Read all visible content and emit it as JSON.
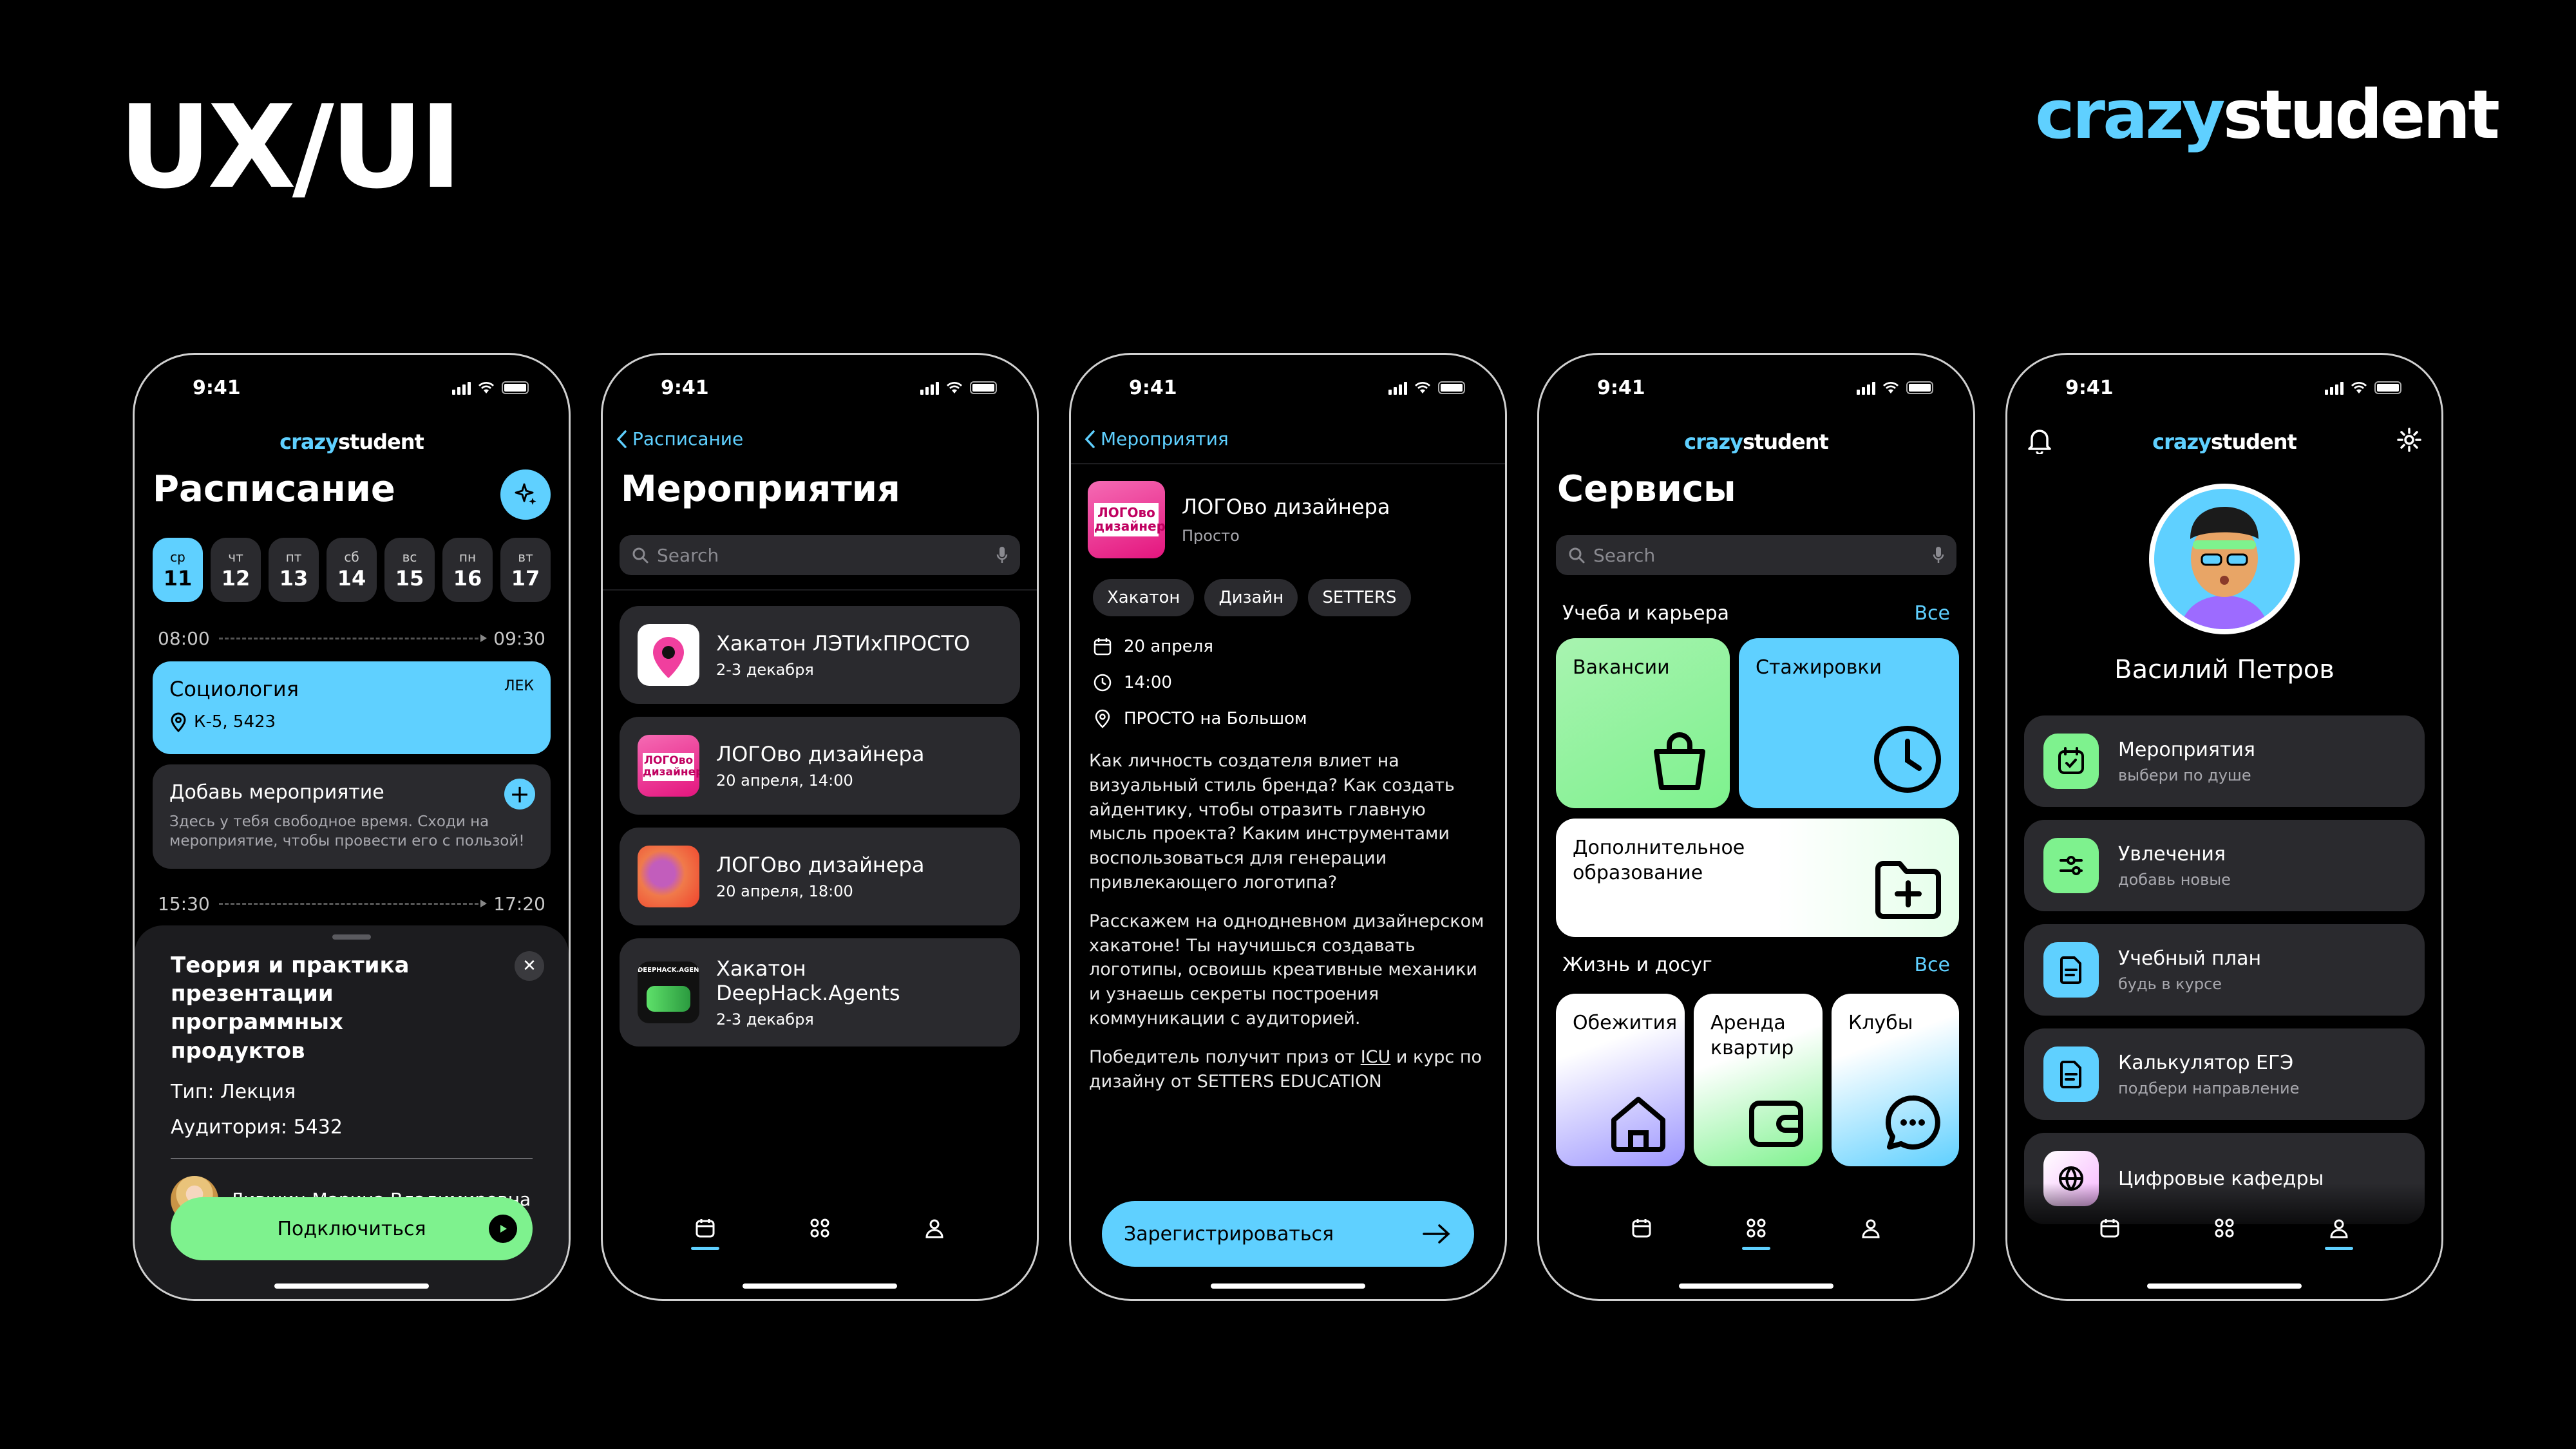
{
  "header": {
    "title": "UX/UI",
    "brand_part1": "crazy",
    "brand_part2": "student"
  },
  "colors": {
    "accent": "#5fd0ff",
    "green": "#7ef28e",
    "card": "#2a2a2e"
  },
  "status_time": "9:41",
  "schedule": {
    "logo1": "crazy",
    "logo2": "student",
    "title": "Расписание",
    "days": [
      {
        "w": "ср",
        "n": "11"
      },
      {
        "w": "чт",
        "n": "12"
      },
      {
        "w": "пт",
        "n": "13"
      },
      {
        "w": "сб",
        "n": "14"
      },
      {
        "w": "вс",
        "n": "15"
      },
      {
        "w": "пн",
        "n": "16"
      },
      {
        "w": "вт",
        "n": "17"
      }
    ],
    "slot1_start": "08:00",
    "slot1_end": "09:30",
    "lesson_title": "Социология",
    "lesson_kind": "ЛЕК",
    "lesson_room": "К-5, 5423",
    "add_title": "Добавь мероприятие",
    "add_desc": "Здесь у тебя свободное время. Сходи на мероприятие, чтобы провести его с пользой!",
    "slot2_start": "15:30",
    "slot2_end": "17:20",
    "sheet_title": "Теория и практика презентации программных продуктов",
    "sheet_type": "Тип: Лекция",
    "sheet_room": "Аудитория: 5432",
    "teacher": "Лившиц Марина Владимировна",
    "connect": "Подключиться"
  },
  "events": {
    "back": "Расписание",
    "title": "Мероприятия",
    "search_placeholder": "Search",
    "items": [
      {
        "title": "Хакатон ЛЭТИхПРОСТО",
        "sub": "2-3 декабря"
      },
      {
        "title": "ЛОГОво дизайнера",
        "sub": "20 апреля, 14:00"
      },
      {
        "title": "ЛОГОво дизайнера",
        "sub": "20 апреля, 18:00"
      },
      {
        "title": "Хакатон",
        "title2": "DeepHack.Agents",
        "sub": "2-3 декабря"
      }
    ],
    "img_logo_text1": "ЛОГОво",
    "img_logo_text2": "дизайнера",
    "img_deephack": "DEEPHACK.AGENTS"
  },
  "detail": {
    "back": "Мероприятия",
    "title": "ЛОГОво дизайнера",
    "org": "Просто",
    "tags": [
      "Хакатон",
      "Дизайн",
      "SETTERS"
    ],
    "date": "20 апреля",
    "time": "14:00",
    "place": "ПРОСТО на Большом",
    "p1": "Как личность создателя влиет на визуальный стиль бренда? Как создать айдентику, чтобы отразить главную мысль проекта? Каким инструментами воспользоваться для генерации привлекающего логотипа?",
    "p2": "Расскажем на однодневном дизайнерском хакатоне! Ты научишься создавать логотипы, освоишь креативные механики и узнаешь секреты построения коммуникации с аудиторией.",
    "p3a": "Победитель получит приз от ",
    "p3b": "ICU",
    "p3c": " и курс по дизайну от SETTERS EDUCATION",
    "register": "Зарегистрироваться"
  },
  "services": {
    "title": "Сервисы",
    "search_placeholder": "Search",
    "sec1": "Учеба и карьера",
    "sec1_all": "Все",
    "vacancies": "Вакансии",
    "internships": "Стажировки",
    "extra_edu1": "Дополнительное",
    "extra_edu2": "образование",
    "sec2": "Жизнь и досуг",
    "sec2_all": "Все",
    "dorms": "Обежития",
    "rent1": "Аренда",
    "rent2": "квартир",
    "clubs": "Клубы"
  },
  "profile": {
    "name": "Василий Петров",
    "menu": [
      {
        "t": "Мероприятия",
        "s": "выбери по душе"
      },
      {
        "t": "Увлечения",
        "s": "добавь новые"
      },
      {
        "t": "Учебный план",
        "s": "будь в курсе"
      },
      {
        "t": "Калькулятор ЕГЭ",
        "s": "подбери направление"
      },
      {
        "t": "Цифровые кафедры",
        "s": ""
      }
    ]
  }
}
